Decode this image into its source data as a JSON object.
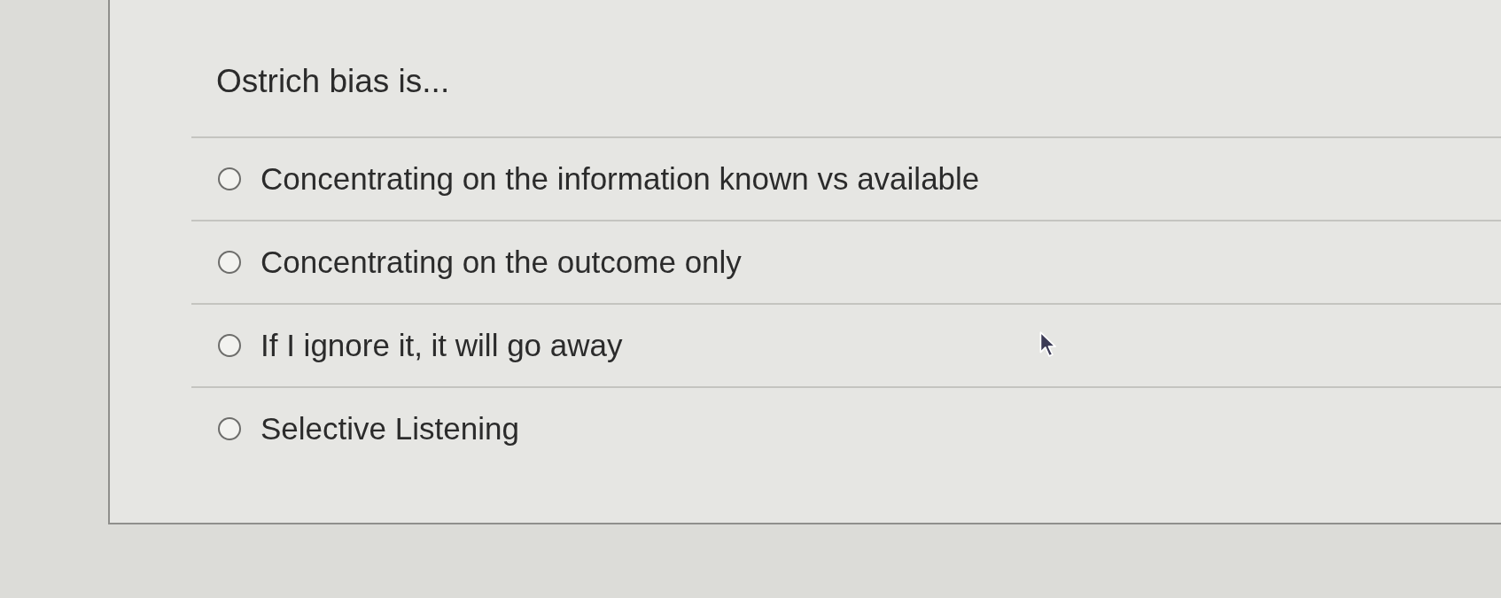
{
  "question": {
    "text": "Ostrich bias is..."
  },
  "options": [
    {
      "label": "Concentrating on the information known vs available",
      "selected": false
    },
    {
      "label": "Concentrating on the outcome only",
      "selected": false
    },
    {
      "label": "If I ignore it, it will go away",
      "selected": false
    },
    {
      "label": "Selective Listening",
      "selected": false
    }
  ]
}
